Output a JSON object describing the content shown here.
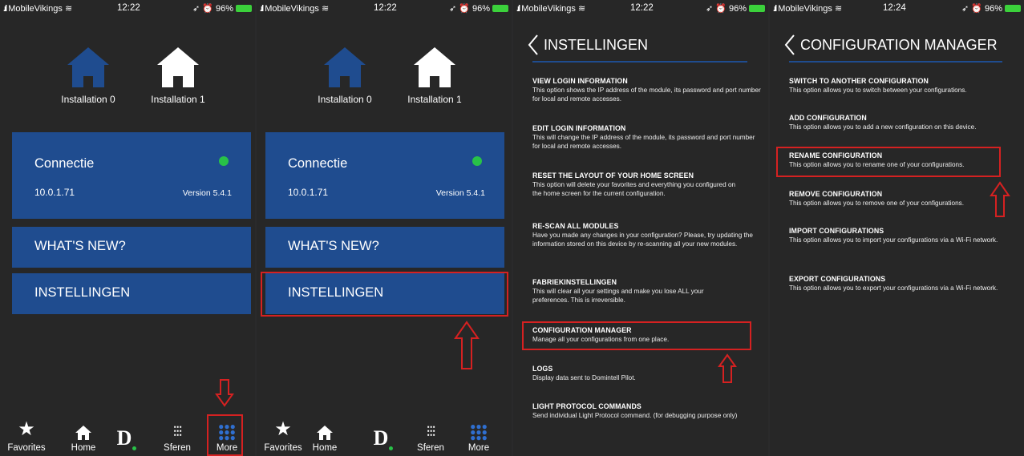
{
  "status": {
    "carrier": "MobileVikings",
    "battery": "96%",
    "times": [
      "12:22",
      "12:22",
      "12:22",
      "12:24"
    ]
  },
  "home": {
    "installations": [
      "Installation 0",
      "Installation 1"
    ],
    "connection": {
      "title": "Connectie",
      "ip": "10.0.1.71",
      "version": "Version 5.4.1"
    },
    "whats_new": "WHAT'S NEW?",
    "settings": "INSTELLINGEN"
  },
  "tabbar": {
    "items": [
      {
        "label": "Favorites",
        "icon": "star-icon"
      },
      {
        "label": "Home",
        "icon": "home-icon"
      },
      {
        "label": "",
        "icon": "domintell-logo-icon"
      },
      {
        "label": "Sferen",
        "icon": "sliders-icon"
      },
      {
        "label": "More",
        "icon": "grid-icon"
      }
    ]
  },
  "settings_screen": {
    "title": "INSTELLINGEN",
    "options": [
      {
        "title": "VIEW LOGIN INFORMATION",
        "desc": "This option shows the IP address of the module, its password and port number for local and remote accesses."
      },
      {
        "title": "EDIT LOGIN INFORMATION",
        "desc": "This will change the IP address of the module, its password and port number for local and remote accesses."
      },
      {
        "title": "RESET THE LAYOUT OF YOUR HOME SCREEN",
        "desc": "This option will delete your favorites and everything you configured on the home screen for the current configuration."
      },
      {
        "title": "RE-SCAN ALL MODULES",
        "desc": "Have you made any changes in your configuration? Please, try updating the information stored on this device by re-scanning all your new modules."
      },
      {
        "title": "FABRIEKINSTELLINGEN",
        "desc": "This will clear all your settings and make you lose ALL your preferences. This is irreversible."
      },
      {
        "title": "CONFIGURATION MANAGER",
        "desc": "Manage all your configurations from one place."
      },
      {
        "title": "LOGS",
        "desc": "Display data sent to Domintell Pilot."
      },
      {
        "title": "LIGHT PROTOCOL COMMANDS",
        "desc": "Send individual Light Protocol command. (for debugging purpose only)"
      }
    ]
  },
  "config_screen": {
    "title": "CONFIGURATION MANAGER",
    "options": [
      {
        "title": "SWITCH TO ANOTHER CONFIGURATION",
        "desc": "This option allows you to switch between your configurations."
      },
      {
        "title": "ADD CONFIGURATION",
        "desc": "This option allows you to add a new configuration on this device."
      },
      {
        "title": "RENAME CONFIGURATION",
        "desc": "This option allows you to rename one of your configurations."
      },
      {
        "title": "REMOVE CONFIGURATION",
        "desc": "This option allows you to remove one of your configurations."
      },
      {
        "title": "IMPORT CONFIGURATIONS",
        "desc": "This option allows you to import your configurations via a Wi-Fi network."
      },
      {
        "title": "EXPORT CONFIGURATIONS",
        "desc": "This option allows you to export your configurations via a Wi-Fi network."
      }
    ]
  },
  "colors": {
    "tile": "#1f4c8f",
    "background": "#272727",
    "highlight": "#d52121",
    "online": "#28c248"
  }
}
